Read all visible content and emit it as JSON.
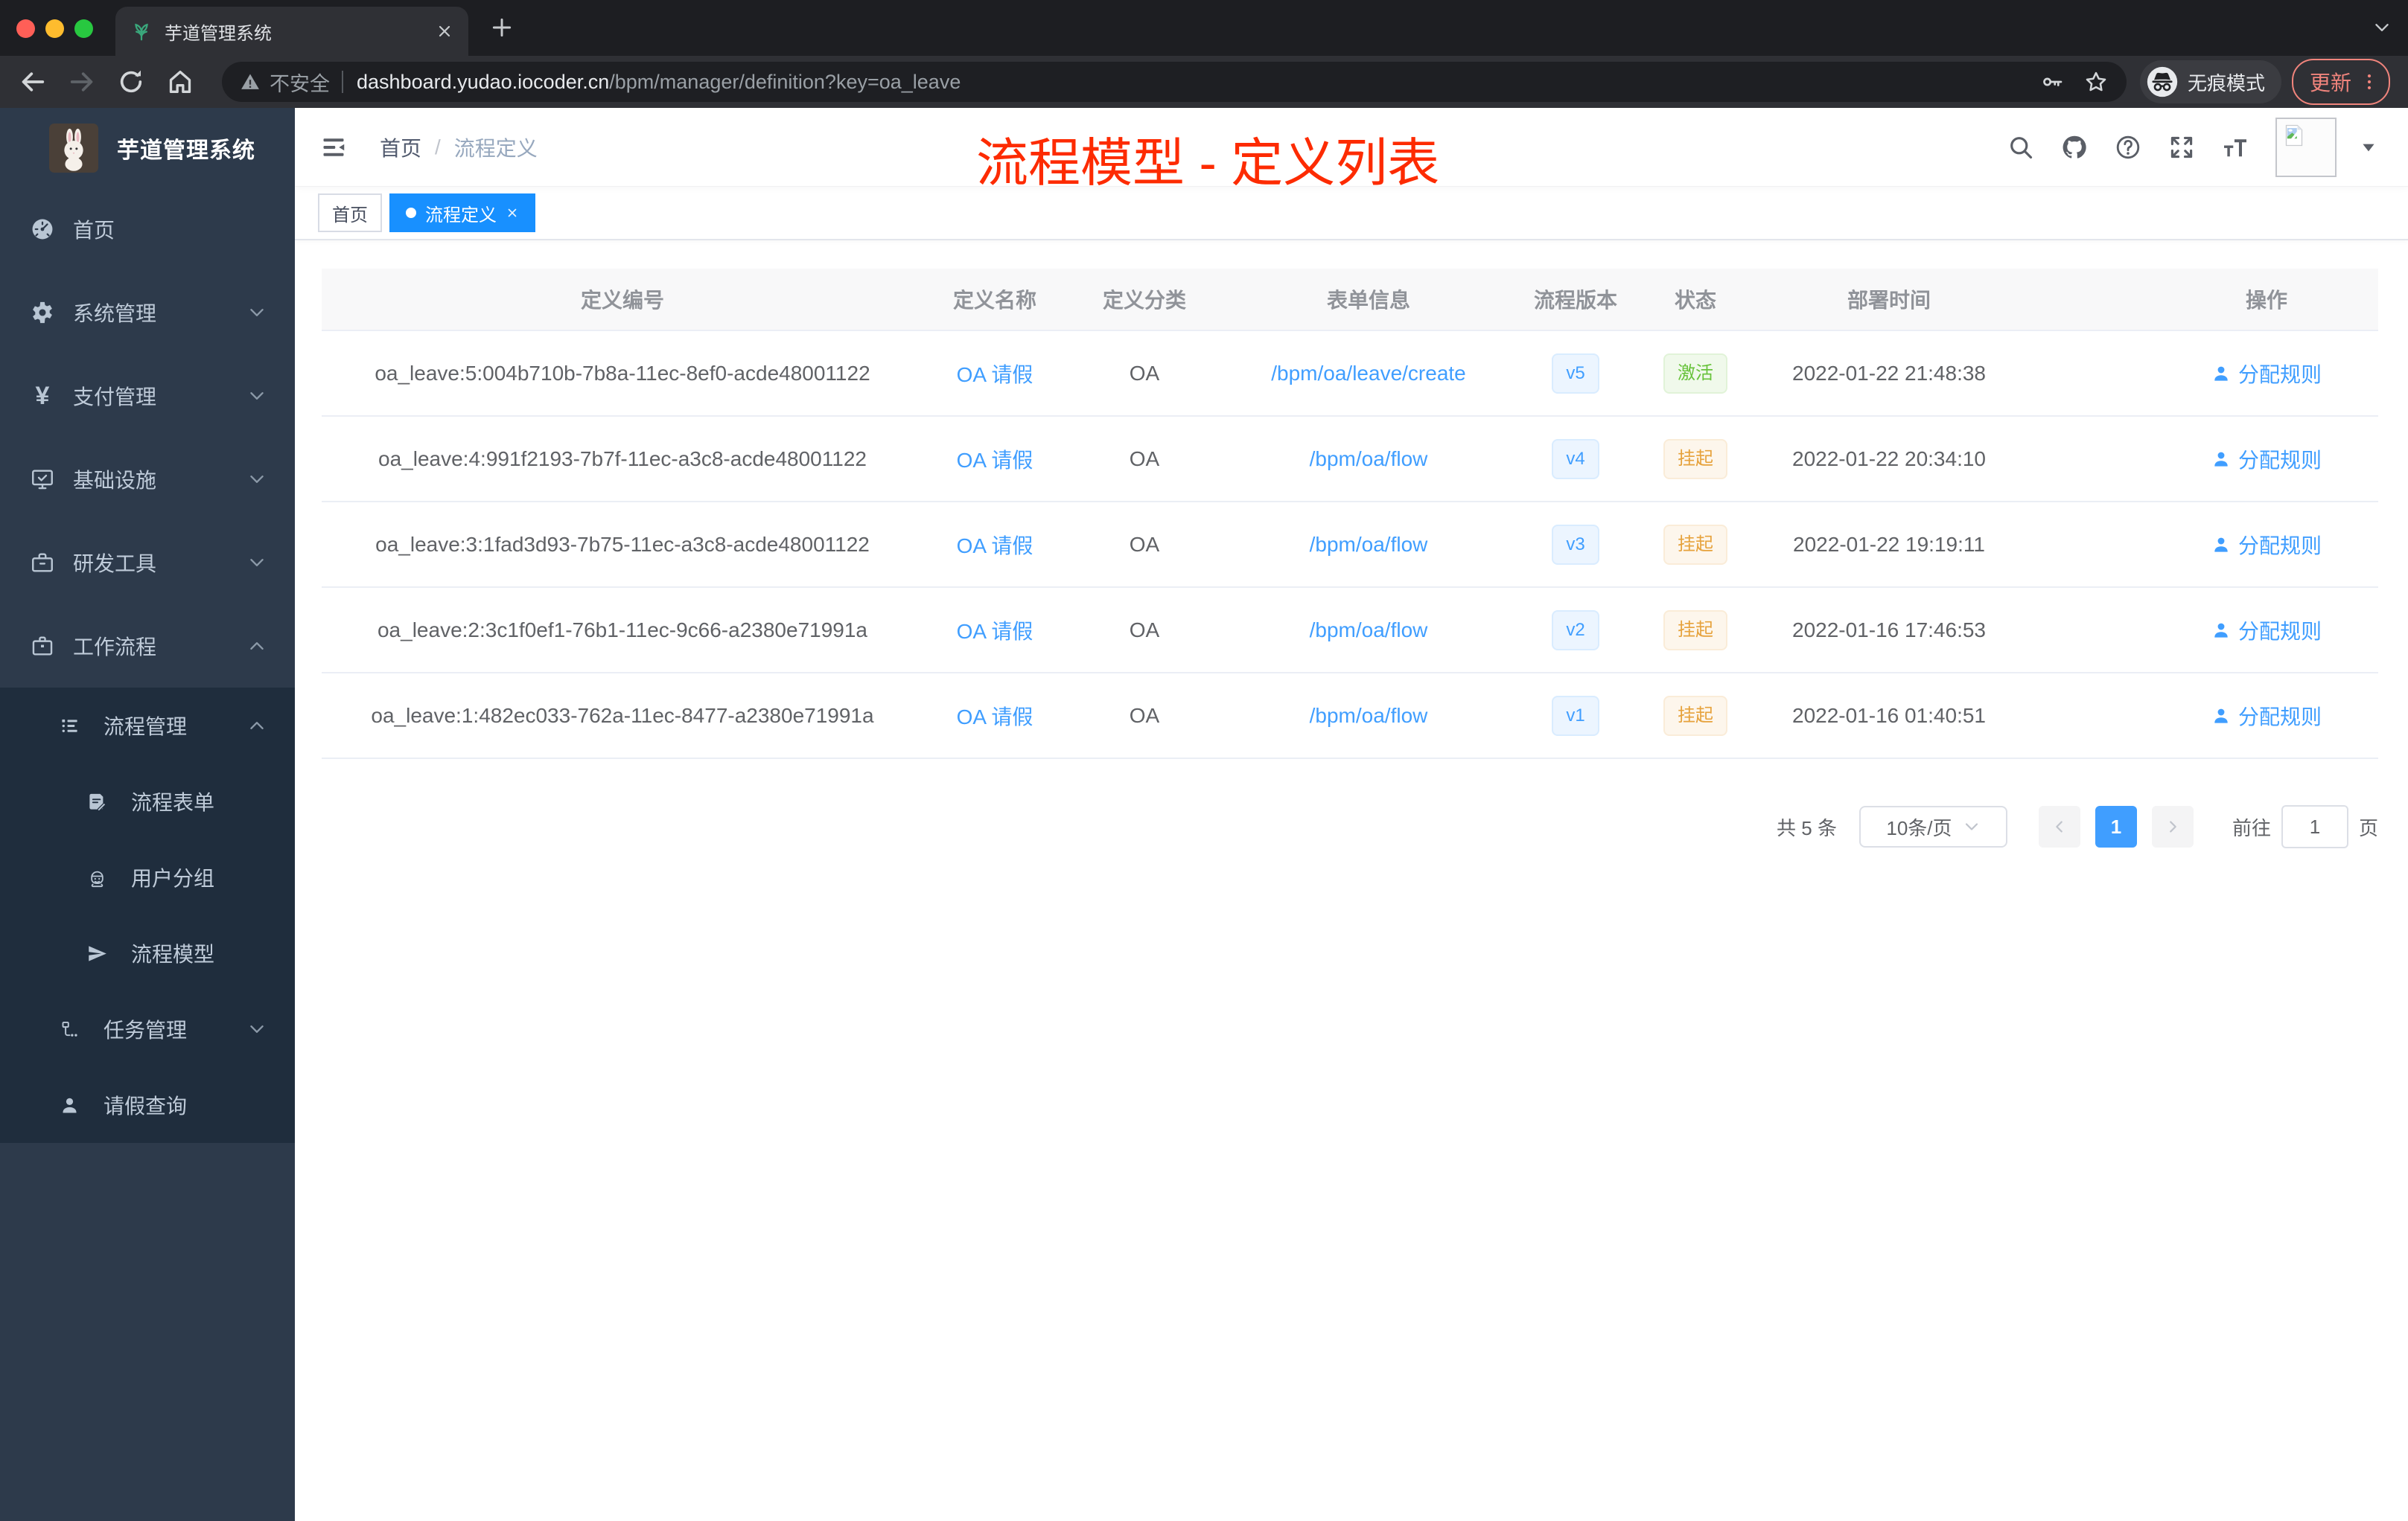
{
  "browser": {
    "tab_title": "芋道管理系统",
    "security_label": "不安全",
    "url_domain": "dashboard.yudao.iocoder.cn",
    "url_path": "/bpm/manager/definition?key=oa_leave",
    "incognito_label": "无痕模式",
    "update_label": "更新"
  },
  "sidebar": {
    "logo_title": "芋道管理系统",
    "items": [
      {
        "label": "首页",
        "icon": "gauge",
        "level": 1,
        "arrow": null,
        "dark": false
      },
      {
        "label": "系统管理",
        "icon": "gear",
        "level": 1,
        "arrow": "down",
        "dark": false
      },
      {
        "label": "支付管理",
        "icon": "yen",
        "level": 1,
        "arrow": "down",
        "dark": false
      },
      {
        "label": "基础设施",
        "icon": "monitor",
        "level": 1,
        "arrow": "down",
        "dark": false
      },
      {
        "label": "研发工具",
        "icon": "toolbox",
        "level": 1,
        "arrow": "down",
        "dark": false
      },
      {
        "label": "工作流程",
        "icon": "briefcase",
        "level": 1,
        "arrow": "up",
        "dark": false
      },
      {
        "label": "流程管理",
        "icon": "list-tree",
        "level": 2,
        "arrow": "up",
        "dark": true
      },
      {
        "label": "流程表单",
        "icon": "form-edit",
        "level": 3,
        "arrow": null,
        "dark": true
      },
      {
        "label": "用户分组",
        "icon": "robot",
        "level": 3,
        "arrow": null,
        "dark": true
      },
      {
        "label": "流程模型",
        "icon": "paper-plane",
        "level": 3,
        "arrow": null,
        "dark": true
      },
      {
        "label": "任务管理",
        "icon": "flow",
        "level": 2,
        "arrow": "down",
        "dark": true
      },
      {
        "label": "请假查询",
        "icon": "user",
        "level": 2,
        "arrow": null,
        "dark": true
      }
    ]
  },
  "header": {
    "breadcrumb": [
      "首页",
      "流程定义"
    ],
    "tools": [
      {
        "name": "search"
      },
      {
        "name": "github"
      },
      {
        "name": "help"
      },
      {
        "name": "fullscreen"
      },
      {
        "name": "font-size"
      }
    ],
    "annotation": "流程模型 - 定义列表",
    "annotation_color": "#fd2b01"
  },
  "tags": [
    {
      "label": "首页",
      "active": false
    },
    {
      "label": "流程定义",
      "active": true
    }
  ],
  "table": {
    "columns": [
      "定义编号",
      "定义名称",
      "定义分类",
      "表单信息",
      "流程版本",
      "状态",
      "部署时间",
      "操作"
    ],
    "action_label": "分配规则",
    "rows": [
      {
        "id": "oa_leave:5:004b710b-7b8a-11ec-8ef0-acde48001122",
        "name": "OA 请假",
        "category": "OA",
        "form": "/bpm/oa/leave/create",
        "version": "v5",
        "status": "激活",
        "status_type": "active",
        "deployed_at": "2022-01-22 21:48:38"
      },
      {
        "id": "oa_leave:4:991f2193-7b7f-11ec-a3c8-acde48001122",
        "name": "OA 请假",
        "category": "OA",
        "form": "/bpm/oa/flow",
        "version": "v4",
        "status": "挂起",
        "status_type": "suspended",
        "deployed_at": "2022-01-22 20:34:10"
      },
      {
        "id": "oa_leave:3:1fad3d93-7b75-11ec-a3c8-acde48001122",
        "name": "OA 请假",
        "category": "OA",
        "form": "/bpm/oa/flow",
        "version": "v3",
        "status": "挂起",
        "status_type": "suspended",
        "deployed_at": "2022-01-22 19:19:11"
      },
      {
        "id": "oa_leave:2:3c1f0ef1-76b1-11ec-9c66-a2380e71991a",
        "name": "OA 请假",
        "category": "OA",
        "form": "/bpm/oa/flow",
        "version": "v2",
        "status": "挂起",
        "status_type": "suspended",
        "deployed_at": "2022-01-16 17:46:53"
      },
      {
        "id": "oa_leave:1:482ec033-762a-11ec-8477-a2380e71991a",
        "name": "OA 请假",
        "category": "OA",
        "form": "/bpm/oa/flow",
        "version": "v1",
        "status": "挂起",
        "status_type": "suspended",
        "deployed_at": "2022-01-16 01:40:51"
      }
    ]
  },
  "pagination": {
    "total_label": "共 5 条",
    "page_size": "10条/页",
    "current_page": "1",
    "goto_label": "前往",
    "goto_value": "1",
    "page_suffix": "页"
  },
  "colors": {
    "accent": "#409eff",
    "active_tag": "#1890ff",
    "annotation_red": "#fd2b01",
    "sidebar_bg": "#2d3a4b",
    "sidebar_submenu_bg": "#1f2d3d",
    "status_active": "#67c23a",
    "status_suspended": "#e6a23c",
    "table_header_bg": "#f8f8f9"
  }
}
